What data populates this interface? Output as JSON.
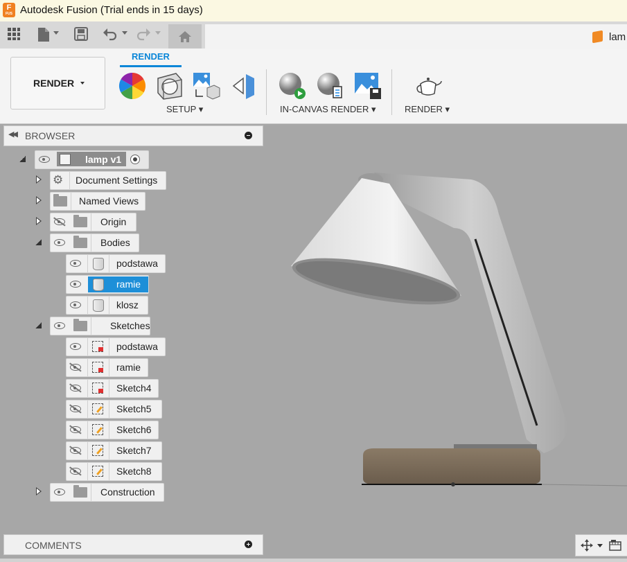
{
  "window": {
    "title": "Autodesk Fusion (Trial ends in 15 days)",
    "app_icon_letter": "F"
  },
  "quick_access": {
    "doc_tab_label": "lam"
  },
  "ribbon": {
    "workspace_label": "RENDER",
    "active_tab": "RENDER",
    "groups": [
      {
        "label": "SETUP ▾"
      },
      {
        "label": "IN-CANVAS RENDER ▾"
      },
      {
        "label": "RENDER ▾"
      }
    ]
  },
  "browser": {
    "title": "BROWSER",
    "root": {
      "label": "lamp v1"
    },
    "nodes": [
      {
        "label": "Document Settings"
      },
      {
        "label": "Named Views"
      },
      {
        "label": "Origin"
      },
      {
        "label": "Bodies"
      },
      {
        "label": "podstawa"
      },
      {
        "label": "ramie"
      },
      {
        "label": "klosz"
      },
      {
        "label": "Sketches"
      },
      {
        "label": "podstawa"
      },
      {
        "label": "ramie"
      },
      {
        "label": "Sketch4"
      },
      {
        "label": "Sketch5"
      },
      {
        "label": "Sketch6"
      },
      {
        "label": "Sketch7"
      },
      {
        "label": "Sketch8"
      },
      {
        "label": "Construction"
      }
    ]
  },
  "comments": {
    "title": "COMMENTS"
  },
  "colors": {
    "accent": "#0a86d8",
    "selection": "#1e8fd8",
    "canvas": "#a7a7a7",
    "lamp_base": "#7a6b58"
  }
}
